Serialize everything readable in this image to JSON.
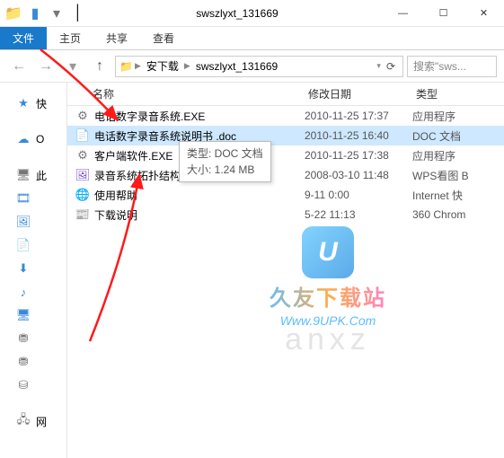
{
  "window": {
    "title": "swszlyxt_131669",
    "min": "—",
    "max": "☐",
    "close": "✕"
  },
  "ribbon": {
    "file": "文件",
    "home": "主页",
    "share": "共享",
    "view": "查看"
  },
  "nav": {
    "crumb1": "安下载",
    "crumb2": "swszlyxt_131669",
    "search_placeholder": "搜索\"sws..."
  },
  "columns": {
    "name": "名称",
    "date": "修改日期",
    "type": "类型"
  },
  "sidebar": {
    "quick": "快",
    "cloud": "O",
    "pc": "此",
    "net": "网",
    "icons": {
      "star": "★",
      "cloud": "☁",
      "pc": "🖥",
      "video": "🎞",
      "image": "🖼",
      "doc": "📄",
      "download": "⬇",
      "music": "♪",
      "desktop": "🖥",
      "disk": "⛃",
      "drive": "⛁",
      "net": "🖧"
    }
  },
  "files": [
    {
      "icon": "⚙",
      "icls": "i-grey",
      "name": "电话数字录音系统.EXE",
      "date": "2010-11-25 17:37",
      "type": "应用程序",
      "sel": false
    },
    {
      "icon": "📄",
      "icls": "i-blue",
      "name": "电话数字录音系统说明书 .doc",
      "date": "2010-11-25 16:40",
      "type": "DOC 文档",
      "sel": true
    },
    {
      "icon": "⚙",
      "icls": "i-grey",
      "name": "客户端软件.EXE",
      "date": "2010-11-25 17:38",
      "type": "应用程序",
      "sel": false
    },
    {
      "icon": "🖼",
      "icls": "i-purple",
      "name": "录音系统拓扑结构.bmp",
      "date": "2008-03-10 11:48",
      "type": "WPS看图 B",
      "sel": false
    },
    {
      "icon": "🌐",
      "icls": "i-blue",
      "name": "使用帮助",
      "date": "          9-11 0:00",
      "type": "Internet 快",
      "sel": false
    },
    {
      "icon": "📰",
      "icls": "i-green",
      "name": "下载说明",
      "date": "          5-22 11:13",
      "type": "360 Chrom",
      "sel": false
    }
  ],
  "tooltip": {
    "line1": "类型: DOC 文档",
    "line2": "大小: 1.24 MB"
  },
  "watermark": {
    "logo_letter": "U",
    "text": "久友下载站",
    "url": "Www.9UPK.Com",
    "bg": "anxz"
  }
}
